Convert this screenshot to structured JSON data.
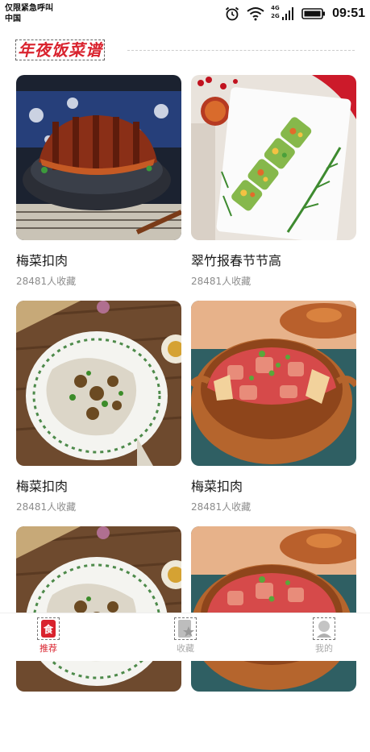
{
  "status_bar": {
    "carrier_line1": "仅限紧急呼叫",
    "carrier_line2": "中国",
    "network_1": "4G",
    "network_2": "2G",
    "time": "09:51"
  },
  "header": {
    "title": "年夜饭菜谱"
  },
  "recipes": [
    {
      "title": "梅菜扣肉",
      "favorites": "28481人收藏",
      "image": "braised-pork-dish"
    },
    {
      "title": "翠竹报春节节高",
      "favorites": "28481人收藏",
      "image": "cucumber-bamboo-dish"
    },
    {
      "title": "梅菜扣肉",
      "favorites": "28481人收藏",
      "image": "steamed-fish-dish"
    },
    {
      "title": "梅菜扣肉",
      "favorites": "28481人收藏",
      "image": "clay-pot-dish"
    },
    {
      "title": "",
      "favorites": "",
      "image": "steamed-fish-dish"
    },
    {
      "title": "",
      "favorites": "",
      "image": "clay-pot-dish"
    }
  ],
  "nav": {
    "items": [
      {
        "label": "推荐",
        "icon": "recommend-icon",
        "active": true
      },
      {
        "label": "收藏",
        "icon": "favorite-icon",
        "active": false
      },
      {
        "label": "我的",
        "icon": "profile-icon",
        "active": false
      }
    ],
    "active_color": "#d9232e",
    "inactive_color": "#aaaaaa"
  },
  "colors": {
    "accent": "#d9232e",
    "subtitle": "#8c8c8c"
  }
}
